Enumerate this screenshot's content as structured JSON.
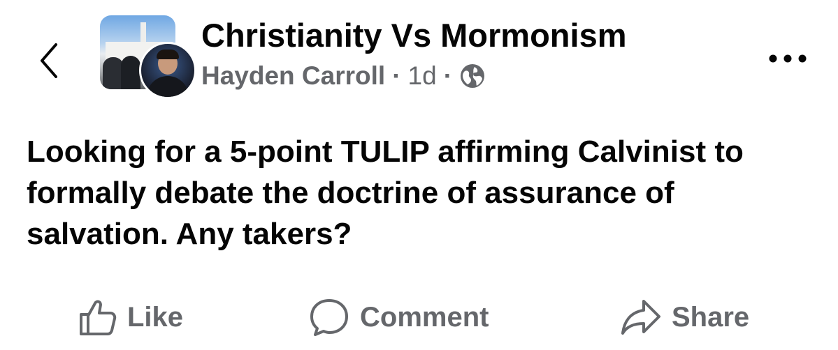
{
  "header": {
    "group_name": "Christianity Vs Mormonism",
    "author": "Hayden Carroll",
    "separator": "·",
    "time": "1d",
    "privacy_icon": "globe-icon",
    "back_icon": "chevron-left-icon",
    "more_icon": "more-horizontal-icon"
  },
  "post": {
    "text": "Looking for a 5-point TULIP affirming Calvinist to formally debate the doctrine of assurance of salvation. Any takers?"
  },
  "actions": [
    {
      "label": "Like",
      "icon": "thumbs-up-icon"
    },
    {
      "label": "Comment",
      "icon": "comment-bubble-icon"
    },
    {
      "label": "Share",
      "icon": "share-arrow-icon"
    }
  ],
  "colors": {
    "primary_text": "#050505",
    "secondary_text": "#65676b",
    "background": "#ffffff"
  }
}
